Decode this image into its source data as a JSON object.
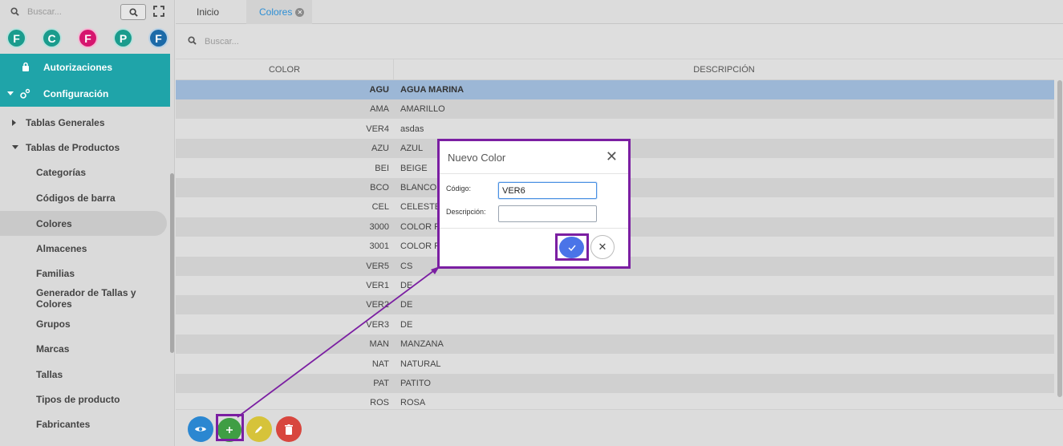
{
  "sidebar": {
    "search_placeholder": "Buscar...",
    "avatars": [
      {
        "letter": "F",
        "color": "#1a9c8d"
      },
      {
        "letter": "C",
        "color": "#1a9c8d"
      },
      {
        "letter": "F",
        "color": "#d6156e"
      },
      {
        "letter": "P",
        "color": "#1a9c8d"
      },
      {
        "letter": "F",
        "color": "#1c6aa8"
      }
    ],
    "teal_items": [
      {
        "label": "Autorizaciones",
        "icon": "lock-icon"
      },
      {
        "label": "Configuración",
        "icon": "gears-icon"
      }
    ],
    "groups": [
      {
        "label": "Tablas Generales",
        "expanded": false
      },
      {
        "label": "Tablas de Productos",
        "expanded": true
      }
    ],
    "items": [
      {
        "label": "Categorías"
      },
      {
        "label": "Códigos de barra"
      },
      {
        "label": "Colores"
      },
      {
        "label": "Almacenes"
      },
      {
        "label": "Familias"
      },
      {
        "label": "Generador de Tallas y Colores"
      },
      {
        "label": "Grupos"
      },
      {
        "label": "Marcas"
      },
      {
        "label": "Tallas"
      },
      {
        "label": "Tipos de producto"
      },
      {
        "label": "Fabricantes"
      }
    ],
    "active_item": "Colores"
  },
  "tabs": [
    {
      "label": "Inicio"
    },
    {
      "label": "Colores"
    }
  ],
  "main": {
    "search_placeholder": "Buscar...",
    "columns": [
      "COLOR",
      "DESCRIPCIÓN"
    ],
    "rows": [
      {
        "code": "AGU",
        "desc": "AGUA MARINA"
      },
      {
        "code": "AMA",
        "desc": "AMARILLO"
      },
      {
        "code": "VER4",
        "desc": "asdas"
      },
      {
        "code": "AZU",
        "desc": "AZUL"
      },
      {
        "code": "BEI",
        "desc": "BEIGE"
      },
      {
        "code": "BCO",
        "desc": "BLANCO"
      },
      {
        "code": "CEL",
        "desc": "CELESTE"
      },
      {
        "code": "3000",
        "desc": "COLOR F"
      },
      {
        "code": "3001",
        "desc": "COLOR F"
      },
      {
        "code": "VER5",
        "desc": "CS"
      },
      {
        "code": "VER1",
        "desc": "DE"
      },
      {
        "code": "VER2",
        "desc": "DE"
      },
      {
        "code": "VER3",
        "desc": "DE"
      },
      {
        "code": "MAN",
        "desc": "MANZANA"
      },
      {
        "code": "NAT",
        "desc": "NATURAL"
      },
      {
        "code": "PAT",
        "desc": "PATITO"
      },
      {
        "code": "ROS",
        "desc": "ROSA"
      }
    ],
    "selected_row": 0
  },
  "toolbar": {
    "buttons": [
      {
        "name": "view-button",
        "icon": "eye-icon",
        "color": "#2b87d1"
      },
      {
        "name": "add-button",
        "icon": "plus-icon",
        "color": "#3f9e44"
      },
      {
        "name": "edit-button",
        "icon": "pencil-icon",
        "color": "#d6c33a"
      },
      {
        "name": "delete-button",
        "icon": "trash-icon",
        "color": "#d8463e"
      }
    ]
  },
  "dialog": {
    "title": "Nuevo Color",
    "codigo_label": "Código:",
    "codigo_value": "VER6",
    "descripcion_label": "Descripción:",
    "descripcion_value": "",
    "accent": "#7b1fa2"
  }
}
